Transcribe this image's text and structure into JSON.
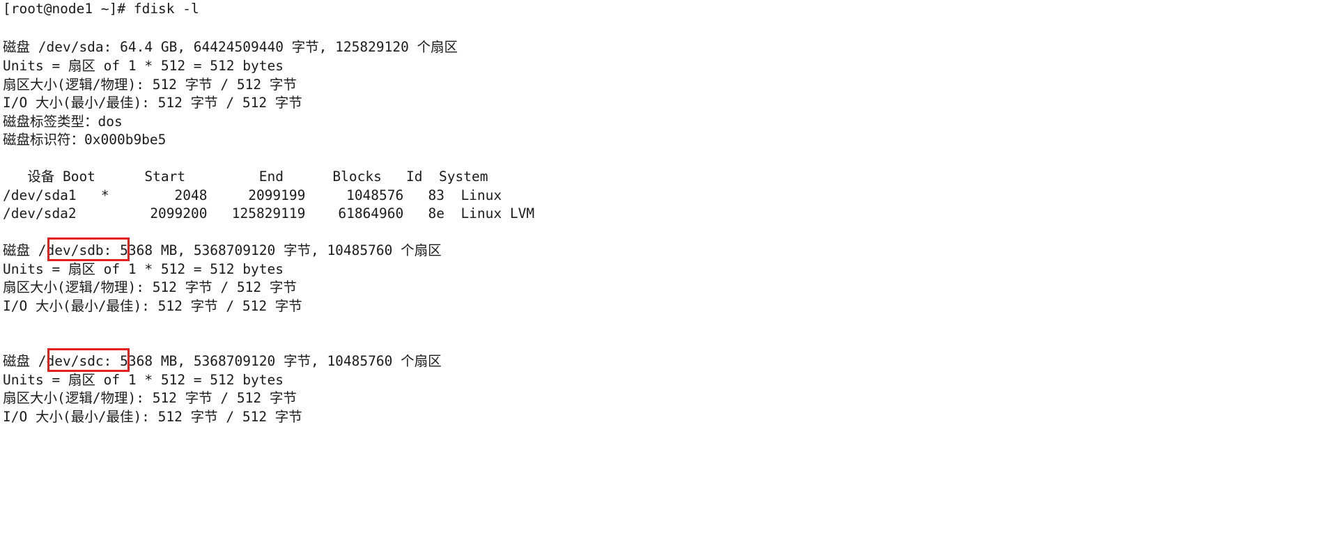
{
  "terminal": {
    "background_color": "#ffffff",
    "text_color": "#1b1b1b",
    "highlight_color": "#e41f1d",
    "prompt_line": "[root@node1 ~]# fdisk -l",
    "blank": ""
  },
  "sda": {
    "disk_line": "磁盘 /dev/sda: 64.4 GB, 64424509440 字节, 125829120 个扇区",
    "units_line": "Units = 扇区 of 1 * 512 = 512 bytes",
    "sector_size_line": "扇区大小(逻辑/物理): 512 字节 / 512 字节",
    "io_size_line": "I/O 大小(最小/最佳): 512 字节 / 512 字节",
    "label_type_line": "磁盘标签类型：dos",
    "identifier_line": "磁盘标识符：0x000b9be5"
  },
  "partition_table": {
    "header": "   设备 Boot      Start         End      Blocks   Id  System",
    "columns": [
      "设备",
      "Boot",
      "Start",
      "End",
      "Blocks",
      "Id",
      "System"
    ],
    "rows": [
      {
        "line": "/dev/sda1   *        2048     2099199     1048576   83  Linux",
        "device": "/dev/sda1",
        "boot": "*",
        "start": "2048",
        "end": "2099199",
        "blocks": "1048576",
        "id": "83",
        "system": "Linux"
      },
      {
        "line": "/dev/sda2         2099200   125829119    61864960   8e  Linux LVM",
        "device": "/dev/sda2",
        "boot": "",
        "start": "2099200",
        "end": "125829119",
        "blocks": "61864960",
        "id": "8e",
        "system": "Linux LVM"
      }
    ]
  },
  "sdb": {
    "disk_prefix": "磁盘 ",
    "disk_device": "/dev/sdb:",
    "disk_suffix": " 5368 MB, 5368709120 字节, 10485760 个扇区",
    "units_line": "Units = 扇区 of 1 * 512 = 512 bytes",
    "sector_size_line": "扇区大小(逻辑/物理): 512 字节 / 512 字节",
    "io_size_line": "I/O 大小(最小/最佳): 512 字节 / 512 字节",
    "highlighted": "true"
  },
  "sdc": {
    "disk_prefix": "磁盘 ",
    "disk_device": "/dev/sdc:",
    "disk_suffix": " 5368 MB, 5368709120 字节, 10485760 个扇区",
    "units_line": "Units = 扇区 of 1 * 512 = 512 bytes",
    "sector_size_line": "扇区大小(逻辑/物理): 512 字节 / 512 字节",
    "io_size_line": "I/O 大小(最小/最佳): 512 字节 / 512 字节",
    "highlighted": "true"
  }
}
